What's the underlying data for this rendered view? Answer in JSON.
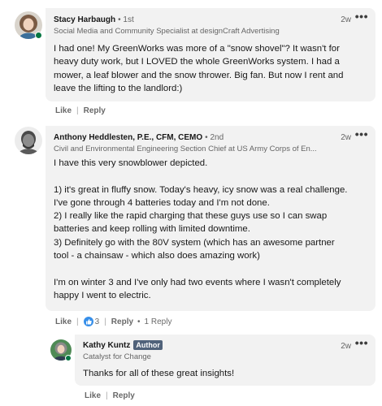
{
  "comments": [
    {
      "author": "Stacy Harbaugh",
      "degree": "• 1st",
      "headline": "Social Media and Community Specialist at designCraft Advertising",
      "time": "2w",
      "body": [
        "I had one! My GreenWorks was more of a \"snow shovel\"? It wasn't for",
        "heavy duty work, but I LOVED the whole GreenWorks system. I had a",
        "mower, a leaf blower and the snow thrower. Big fan. But now I rent and",
        "leave the lifting to the landlord:)"
      ],
      "like_label": "Like",
      "reply_label": "Reply"
    },
    {
      "author": "Anthony Heddlesten, P.E., CFM, CEMO",
      "degree": "• 2nd",
      "headline": "Civil and Environmental Engineering Section Chief at US Army Corps of En...",
      "time": "2w",
      "body": [
        "I have this very snowblower depicted.",
        "",
        "1) it's great in fluffy snow. Today's heavy, icy snow was a real challenge.",
        "I've gone through 4 batteries today and I'm not done.",
        "2) I really like the rapid charging that these guys use so I can swap",
        "batteries and keep rolling with limited downtime.",
        "3) Definitely go with the 80V system (which has an awesome partner",
        "tool - a chainsaw - which also does amazing work)",
        "",
        "I'm on winter 3 and I've only had two events where I wasn't completely",
        "happy I went to electric."
      ],
      "like_label": "Like",
      "reaction_count": "3",
      "reply_label": "Reply",
      "replies_label": "1 Reply"
    },
    {
      "author": "Kathy Kuntz",
      "badge": "Author",
      "headline": "Catalyst for Change",
      "time": "2w",
      "body": [
        "Thanks for all of these great insights!"
      ],
      "like_label": "Like",
      "reply_label": "Reply"
    }
  ],
  "icons": {
    "more": "ellipsis-icon",
    "reaction": "like-reaction-icon",
    "presence": "online-status-icon"
  },
  "colors": {
    "bubble": "#f2f2f2",
    "presence": "#057642",
    "author_badge": "#50627a",
    "reaction": "#378fe9"
  }
}
